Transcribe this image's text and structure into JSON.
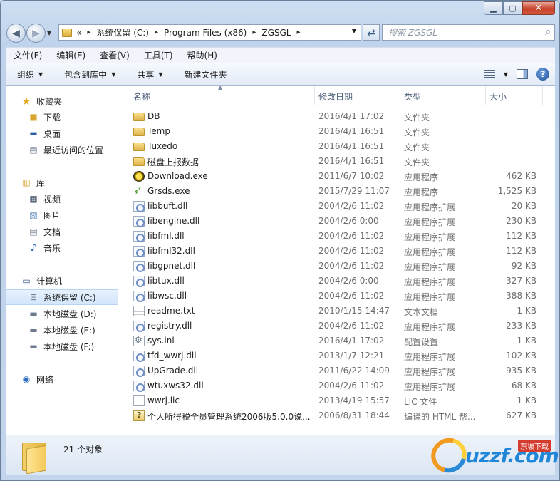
{
  "address": {
    "overflow": "«",
    "crumbs": [
      "系统保留 (C:)",
      "Program Files (x86)",
      "ZGSGL"
    ],
    "search_placeholder": "搜索 ZGSGL"
  },
  "menu": [
    "文件(F)",
    "编辑(E)",
    "查看(V)",
    "工具(T)",
    "帮助(H)"
  ],
  "toolbar": {
    "organize": "组织",
    "include_library": "包含到库中",
    "share": "共享",
    "new_folder": "新建文件夹"
  },
  "nav": {
    "favorites": "收藏夹",
    "downloads": "下载",
    "desktop": "桌面",
    "recent": "最近访问的位置",
    "libraries": "库",
    "videos": "视频",
    "pictures": "图片",
    "documents": "文档",
    "music": "音乐",
    "computer": "计算机",
    "drive_c": "系统保留 (C:)",
    "drive_d": "本地磁盘 (D:)",
    "drive_e": "本地磁盘 (E:)",
    "drive_f": "本地磁盘 (F:)",
    "network": "网络"
  },
  "columns": {
    "name": "名称",
    "date": "修改日期",
    "type": "类型",
    "size": "大小"
  },
  "files": [
    {
      "name": "DB",
      "date": "2016/4/1 17:02",
      "type": "文件夹",
      "size": "",
      "icon": "folder"
    },
    {
      "name": "Temp",
      "date": "2016/4/1 16:51",
      "type": "文件夹",
      "size": "",
      "icon": "folder"
    },
    {
      "name": "Tuxedo",
      "date": "2016/4/1 16:51",
      "type": "文件夹",
      "size": "",
      "icon": "folder"
    },
    {
      "name": "磁盘上报数据",
      "date": "2016/4/1 16:51",
      "type": "文件夹",
      "size": "",
      "icon": "folder"
    },
    {
      "name": "Download.exe",
      "date": "2011/6/7 10:02",
      "type": "应用程序",
      "size": "462 KB",
      "icon": "exe-dl"
    },
    {
      "name": "Grsds.exe",
      "date": "2015/7/29 11:07",
      "type": "应用程序",
      "size": "1,525 KB",
      "icon": "exe-gr"
    },
    {
      "name": "libbuft.dll",
      "date": "2004/2/6 11:02",
      "type": "应用程序扩展",
      "size": "20 KB",
      "icon": "dll"
    },
    {
      "name": "libengine.dll",
      "date": "2004/2/6 0:00",
      "type": "应用程序扩展",
      "size": "230 KB",
      "icon": "dll"
    },
    {
      "name": "libfml.dll",
      "date": "2004/2/6 11:02",
      "type": "应用程序扩展",
      "size": "112 KB",
      "icon": "dll"
    },
    {
      "name": "libfml32.dll",
      "date": "2004/2/6 11:02",
      "type": "应用程序扩展",
      "size": "112 KB",
      "icon": "dll"
    },
    {
      "name": "libgpnet.dll",
      "date": "2004/2/6 11:02",
      "type": "应用程序扩展",
      "size": "92 KB",
      "icon": "dll"
    },
    {
      "name": "libtux.dll",
      "date": "2004/2/6 0:00",
      "type": "应用程序扩展",
      "size": "327 KB",
      "icon": "dll"
    },
    {
      "name": "libwsc.dll",
      "date": "2004/2/6 11:02",
      "type": "应用程序扩展",
      "size": "388 KB",
      "icon": "dll"
    },
    {
      "name": "readme.txt",
      "date": "2010/1/15 14:47",
      "type": "文本文档",
      "size": "1 KB",
      "icon": "txt"
    },
    {
      "name": "registry.dll",
      "date": "2004/2/6 11:02",
      "type": "应用程序扩展",
      "size": "233 KB",
      "icon": "dll"
    },
    {
      "name": "sys.ini",
      "date": "2016/4/1 17:02",
      "type": "配置设置",
      "size": "1 KB",
      "icon": "ini"
    },
    {
      "name": "tfd_wwrj.dll",
      "date": "2013/1/7 12:21",
      "type": "应用程序扩展",
      "size": "102 KB",
      "icon": "dll"
    },
    {
      "name": "UpGrade.dll",
      "date": "2011/6/22 14:09",
      "type": "应用程序扩展",
      "size": "935 KB",
      "icon": "dll"
    },
    {
      "name": "wtuxws32.dll",
      "date": "2004/2/6 11:02",
      "type": "应用程序扩展",
      "size": "68 KB",
      "icon": "dll"
    },
    {
      "name": "wwrj.lic",
      "date": "2013/4/19 15:57",
      "type": "LIC 文件",
      "size": "1 KB",
      "icon": "lic"
    },
    {
      "name": "个人所得税全员管理系统2006版5.0.0说...",
      "date": "2006/8/31 18:44",
      "type": "编译的 HTML 帮...",
      "size": "627 KB",
      "icon": "chm"
    }
  ],
  "status": {
    "count": "21 个对象"
  },
  "watermark": {
    "text": "uzzf.com",
    "tag": "东坡下载"
  }
}
